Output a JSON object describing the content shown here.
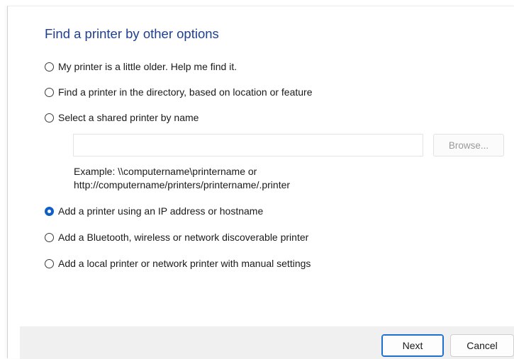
{
  "heading": "Find a printer by other options",
  "options": [
    {
      "label": "My printer is a little older. Help me find it.",
      "checked": false
    },
    {
      "label": "Find a printer in the directory, based on location or feature",
      "checked": false
    },
    {
      "label": "Select a shared printer by name",
      "checked": false
    },
    {
      "label": "Add a printer using an IP address or hostname",
      "checked": true
    },
    {
      "label": "Add a Bluetooth, wireless or network discoverable printer",
      "checked": false
    },
    {
      "label": "Add a local printer or network printer with manual settings",
      "checked": false
    }
  ],
  "shared_printer": {
    "value": "",
    "browse_label": "Browse...",
    "example_line1": "Example: \\\\computername\\printername or",
    "example_line2": "http://computername/printers/printername/.printer"
  },
  "footer": {
    "next_label": "Next",
    "cancel_label": "Cancel"
  },
  "colors": {
    "heading": "#1f3f8f",
    "radio_selected": "#0f5fc7",
    "footer_bg": "#f0f0f0"
  }
}
